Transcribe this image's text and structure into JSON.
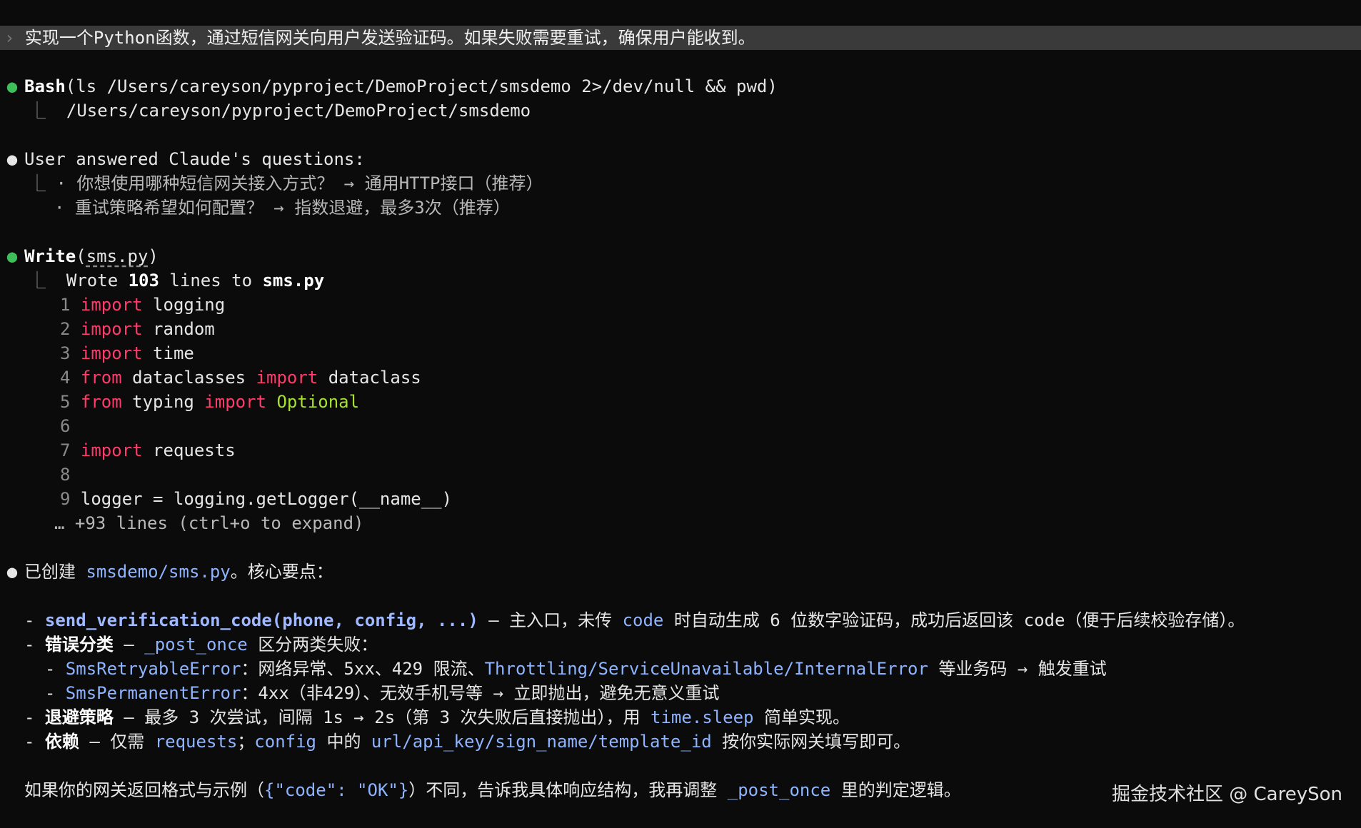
{
  "prompt": {
    "chevron": "›",
    "text": "实现一个Python函数，通过短信网关向用户发送验证码。如果失败需要重试，确保用户能收到。"
  },
  "bash": {
    "tool": "Bash",
    "command": "(ls /Users/careyson/pyproject/DemoProject/smsdemo 2>/dev/null && pwd)",
    "output": "/Users/careyson/pyproject/DemoProject/smsdemo"
  },
  "answers": {
    "header": "User answered Claude's questions:",
    "items": [
      "· 你想使用哪种短信网关接入方式？ → 通用HTTP接口（推荐）",
      "· 重试策略希望如何配置？ → 指数退避，最多3次（推荐）"
    ]
  },
  "write": {
    "tool": "Write",
    "open": "(",
    "file": "sms.py",
    "close": ")",
    "summary_prefix": "Wrote ",
    "line_count": "103",
    "summary_mid": " lines to ",
    "summary_file": "sms.py",
    "code": [
      {
        "n": "1",
        "kw1": "import",
        "t1": " logging",
        "kw2": "",
        "t2": "",
        "ty": ""
      },
      {
        "n": "2",
        "kw1": "import",
        "t1": " random",
        "kw2": "",
        "t2": "",
        "ty": ""
      },
      {
        "n": "3",
        "kw1": "import",
        "t1": " time",
        "kw2": "",
        "t2": "",
        "ty": ""
      },
      {
        "n": "4",
        "kw1": "from",
        "t1": " dataclasses ",
        "kw2": "import",
        "t2": " dataclass",
        "ty": ""
      },
      {
        "n": "5",
        "kw1": "from",
        "t1": " typing ",
        "kw2": "import",
        "t2": " ",
        "ty": "Optional"
      },
      {
        "n": "6",
        "kw1": "",
        "t1": "",
        "kw2": "",
        "t2": "",
        "ty": ""
      },
      {
        "n": "7",
        "kw1": "import",
        "t1": " requests",
        "kw2": "",
        "t2": "",
        "ty": ""
      },
      {
        "n": "8",
        "kw1": "",
        "t1": "",
        "kw2": "",
        "t2": "",
        "ty": ""
      },
      {
        "n": "9",
        "kw1": "",
        "t1": "logger = logging.getLogger(__name__)",
        "kw2": "",
        "t2": "",
        "ty": ""
      }
    ],
    "more": "… +93 lines (ctrl+o to expand)"
  },
  "summary": {
    "intro_a": "已创建 ",
    "intro_path": "smsdemo/sms.py",
    "intro_b": "。核心要点：",
    "l1_dash": "- ",
    "l1_fn": "send_verification_code(phone, config, ...)",
    "l1_a": " — 主入口，未传 ",
    "l1_code": "code",
    "l1_b": " 时自动生成 6 位数字验证码，成功后返回该 code（便于后续校验存储）。",
    "l2_dash": "- ",
    "l2_bold": "错误分类",
    "l2_a": " — ",
    "l2_ref": "_post_once",
    "l2_b": " 区分两类失败：",
    "l3_dash": "  - ",
    "l3_ref": "SmsRetryableError",
    "l3_a": "：网络异常、5xx、429 限流、",
    "l3_ref2": "Throttling/ServiceUnavailable/InternalError",
    "l3_b": " 等业务码 → 触发重试",
    "l4_dash": "  - ",
    "l4_ref": "SmsPermanentError",
    "l4_a": "：4xx（非429）、无效手机号等 → 立即抛出，避免无意义重试",
    "l5_dash": "- ",
    "l5_bold": "退避策略",
    "l5_a": " — 最多 3 次尝试，间隔 1s → 2s（第 3 次失败后直接抛出），用 ",
    "l5_ref": "time.sleep",
    "l5_b": " 简单实现。",
    "l6_dash": "- ",
    "l6_bold": "依赖",
    "l6_a": " — 仅需 ",
    "l6_ref": "requests",
    "l6_b": "；",
    "l6_ref2": "config",
    "l6_c": " 中的 ",
    "l6_ref3": "url/api_key/sign_name/template_id",
    "l6_d": " 按你实际网关填写即可。",
    "closing_a": "如果你的网关返回格式与示例（",
    "closing_code": "{\"code\": \"OK\"}",
    "closing_b": "）不同，告诉我具体响应结构，我再调整 ",
    "closing_ref": "_post_once",
    "closing_c": " 里的判定逻辑。"
  },
  "bullets": {
    "dot": "●",
    "corner": "⎿"
  },
  "watermark": "掘金技术社区 @ CareySon",
  "colors": {
    "background": "#0b0b0b",
    "prompt_bar": "#3a3a3a",
    "green_dot": "#3fbf5a",
    "keyword": "#ff3b6b",
    "type": "#a6e22e",
    "reference": "#8fb4ff"
  }
}
